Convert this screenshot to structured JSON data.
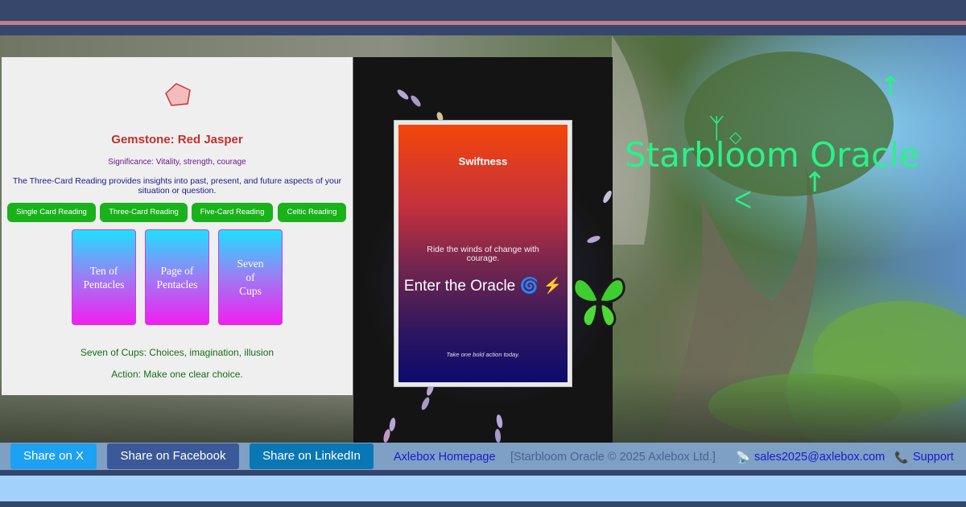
{
  "gemstone": {
    "title": "Gemstone: Red Jasper",
    "significance": "Significance: Vitality, strength, courage",
    "description": "The Three-Card Reading provides insights into past, present, and future aspects of your situation or question."
  },
  "reading_buttons": [
    {
      "label": "Single Card Reading"
    },
    {
      "label": "Three-Card Reading"
    },
    {
      "label": "Five-Card Reading"
    },
    {
      "label": "Celtic Reading"
    }
  ],
  "cards": [
    {
      "name": "Ten of\nPentacles"
    },
    {
      "name": "Page of\nPentacles"
    },
    {
      "name": "Seven\nof\nCups"
    }
  ],
  "card_meaning": "Seven of Cups: Choices, imagination, illusion",
  "card_action": "Action: Make one clear choice.",
  "oracle_card": {
    "title": "Swiftness",
    "description": "Ride the winds of change with courage.",
    "enter": "Enter the Oracle 🌀 ⚡",
    "footer": "Take one bold action today."
  },
  "site_title": "Starbloom Oracle",
  "footer": {
    "share": [
      {
        "label": "Share on X",
        "color": "#1da1f2"
      },
      {
        "label": "Share on Facebook",
        "color": "#3b5998"
      },
      {
        "label": "Share on LinkedIn",
        "color": "#0a77b5"
      }
    ],
    "home_link": "Axlebox Homepage",
    "copyright": "[Starbloom Oracle © 2025 Axlebox Ltd.]",
    "email": "sales2025@axlebox.com",
    "support": "Support"
  },
  "colors": {
    "accent_green": "#19b21b",
    "title_green": "#2af28a",
    "gem_red": "#c0302b"
  }
}
